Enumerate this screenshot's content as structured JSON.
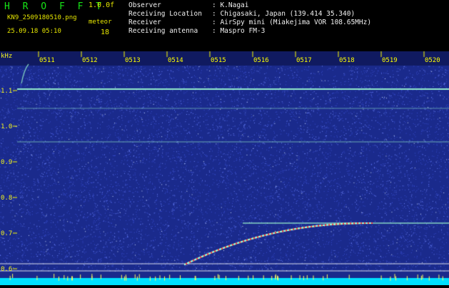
{
  "header": {
    "app_title": "H R O F F T",
    "version": "1.0.0f",
    "filename": "KN9_2509180510.png",
    "datetime": "25.09.18 05:10",
    "status_word": "meteor",
    "count": "18",
    "info": [
      {
        "label": "Observer",
        "value": ": K.Nagai"
      },
      {
        "label": "Receiving Location",
        "value": ": Chigasaki, Japan (139.414 35.340)"
      },
      {
        "label": "Receiver",
        "value": ": AirSpy mini (Miakejima VOR 108.65MHz)"
      },
      {
        "label": "Receiving antenna",
        "value": ": Maspro FM-3"
      }
    ]
  },
  "spectrogram": {
    "y_unit": "kHz",
    "y_ticks": [
      "1.1",
      "1.0",
      "0.9",
      "0.8",
      "0.7",
      "0.6"
    ],
    "time_ticks": [
      "0511",
      "0512",
      "0513",
      "0514",
      "0515",
      "0516",
      "0517",
      "0518",
      "0519",
      "0520"
    ],
    "colors": {
      "background": "#1a2a8c",
      "noise": "#6f86ff",
      "trace": "#a0ffd0",
      "meteor": "#ff4040",
      "bottom_bar": "#00e0ff"
    }
  }
}
